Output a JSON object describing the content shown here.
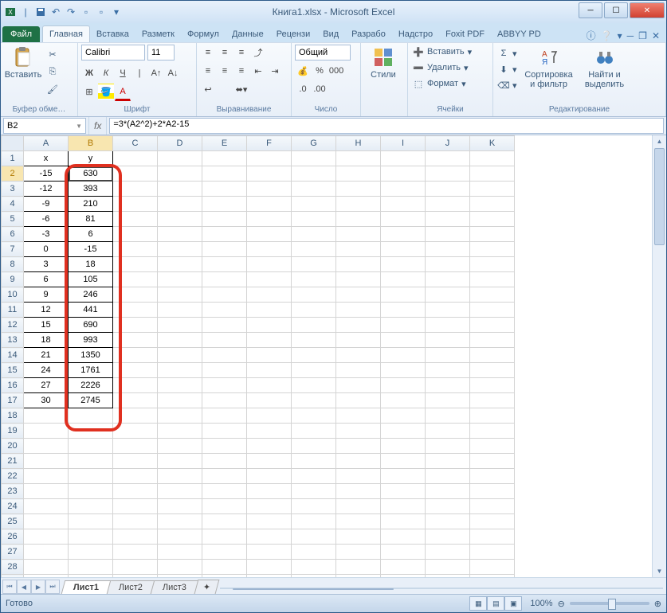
{
  "title": "Книга1.xlsx - Microsoft Excel",
  "tabs": {
    "file": "Файл",
    "home": "Главная",
    "insert": "Вставка",
    "layout": "Разметк",
    "formulas": "Формул",
    "data": "Данные",
    "review": "Рецензи",
    "view": "Вид",
    "dev": "Разрабо",
    "addins": "Надстро",
    "foxit": "Foxit PDF",
    "abbyy": "ABBYY PD"
  },
  "ribbon": {
    "clipboard": {
      "label": "Буфер обме…",
      "paste": "Вставить"
    },
    "font": {
      "label": "Шрифт",
      "name": "Calibri",
      "size": "11"
    },
    "align": {
      "label": "Выравнивание"
    },
    "number": {
      "label": "Число",
      "format": "Общий"
    },
    "styles": {
      "label": "Стили"
    },
    "cells": {
      "label": "Ячейки",
      "insert": "Вставить",
      "delete": "Удалить",
      "format": "Формат"
    },
    "editing": {
      "label": "Редактирование",
      "sort": "Сортировка\nи фильтр",
      "find": "Найти и\nвыделить"
    }
  },
  "namebox": "B2",
  "formula": "=3*(A2^2)+2*A2-15",
  "columns": [
    "A",
    "B",
    "C",
    "D",
    "E",
    "F",
    "G",
    "H",
    "I",
    "J",
    "K"
  ],
  "rows_count": 30,
  "headers": {
    "A": "x",
    "B": "y"
  },
  "data": {
    "A": [
      "-15",
      "-12",
      "-9",
      "-6",
      "-3",
      "0",
      "3",
      "6",
      "9",
      "12",
      "15",
      "18",
      "21",
      "24",
      "27",
      "30"
    ],
    "B": [
      "630",
      "393",
      "210",
      "81",
      "6",
      "-15",
      "18",
      "105",
      "246",
      "441",
      "690",
      "993",
      "1350",
      "1761",
      "2226",
      "2745"
    ]
  },
  "selected_col": "B",
  "selected_row": 2,
  "sheets": [
    "Лист1",
    "Лист2",
    "Лист3"
  ],
  "active_sheet": 0,
  "status": "Готово",
  "zoom": "100%"
}
